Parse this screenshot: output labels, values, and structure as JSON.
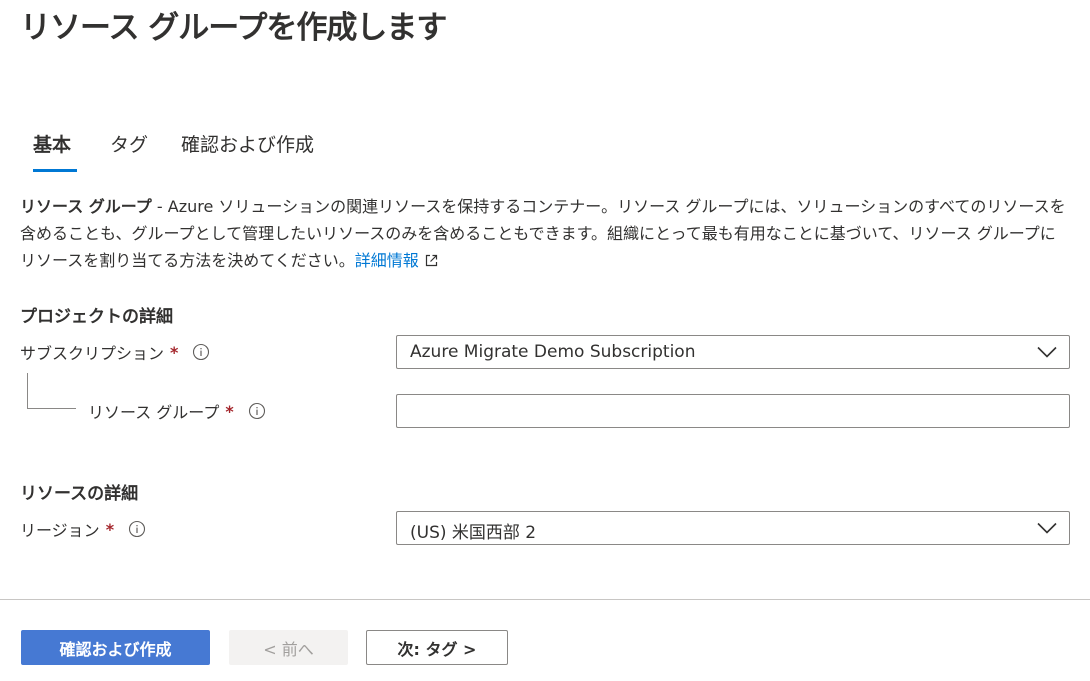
{
  "page": {
    "title": "リソース グループを作成します"
  },
  "tabs": [
    {
      "label": "基本",
      "active": true
    },
    {
      "label": "タグ",
      "active": false
    },
    {
      "label": "確認および作成",
      "active": false
    }
  ],
  "description": {
    "term": "リソース グループ",
    "text": " - Azure ソリューションの関連リソースを保持するコンテナー。リソース グループには、ソリューションのすべてのリソースを含めることも、グループとして管理したいリソースのみを含めることもできます。組織にとって最も有用なことに基づいて、リソース グループにリソースを割り当てる方法を決めてください。",
    "link_label": "詳細情報",
    "link_icon": "external-link-icon"
  },
  "project_details": {
    "heading": "プロジェクトの詳細",
    "subscription": {
      "label": "サブスクリプション",
      "required_marker": "*",
      "value": "Azure Migrate Demo Subscription"
    },
    "resource_group": {
      "label": "リソース グループ",
      "required_marker": "*",
      "value": "",
      "placeholder": ""
    }
  },
  "resource_details": {
    "heading": "リソースの詳細",
    "region": {
      "label": "リージョン",
      "required_marker": "*",
      "value": "(US) 米国西部 2"
    }
  },
  "footer": {
    "review_create_label": "確認および作成",
    "previous_label": "< 前へ",
    "next_label": "次: タグ >"
  },
  "colors": {
    "accent": "#0078d4",
    "primary_button": "#4679d3",
    "required": "#a4262c",
    "text": "#323130",
    "border": "#8a8886"
  }
}
